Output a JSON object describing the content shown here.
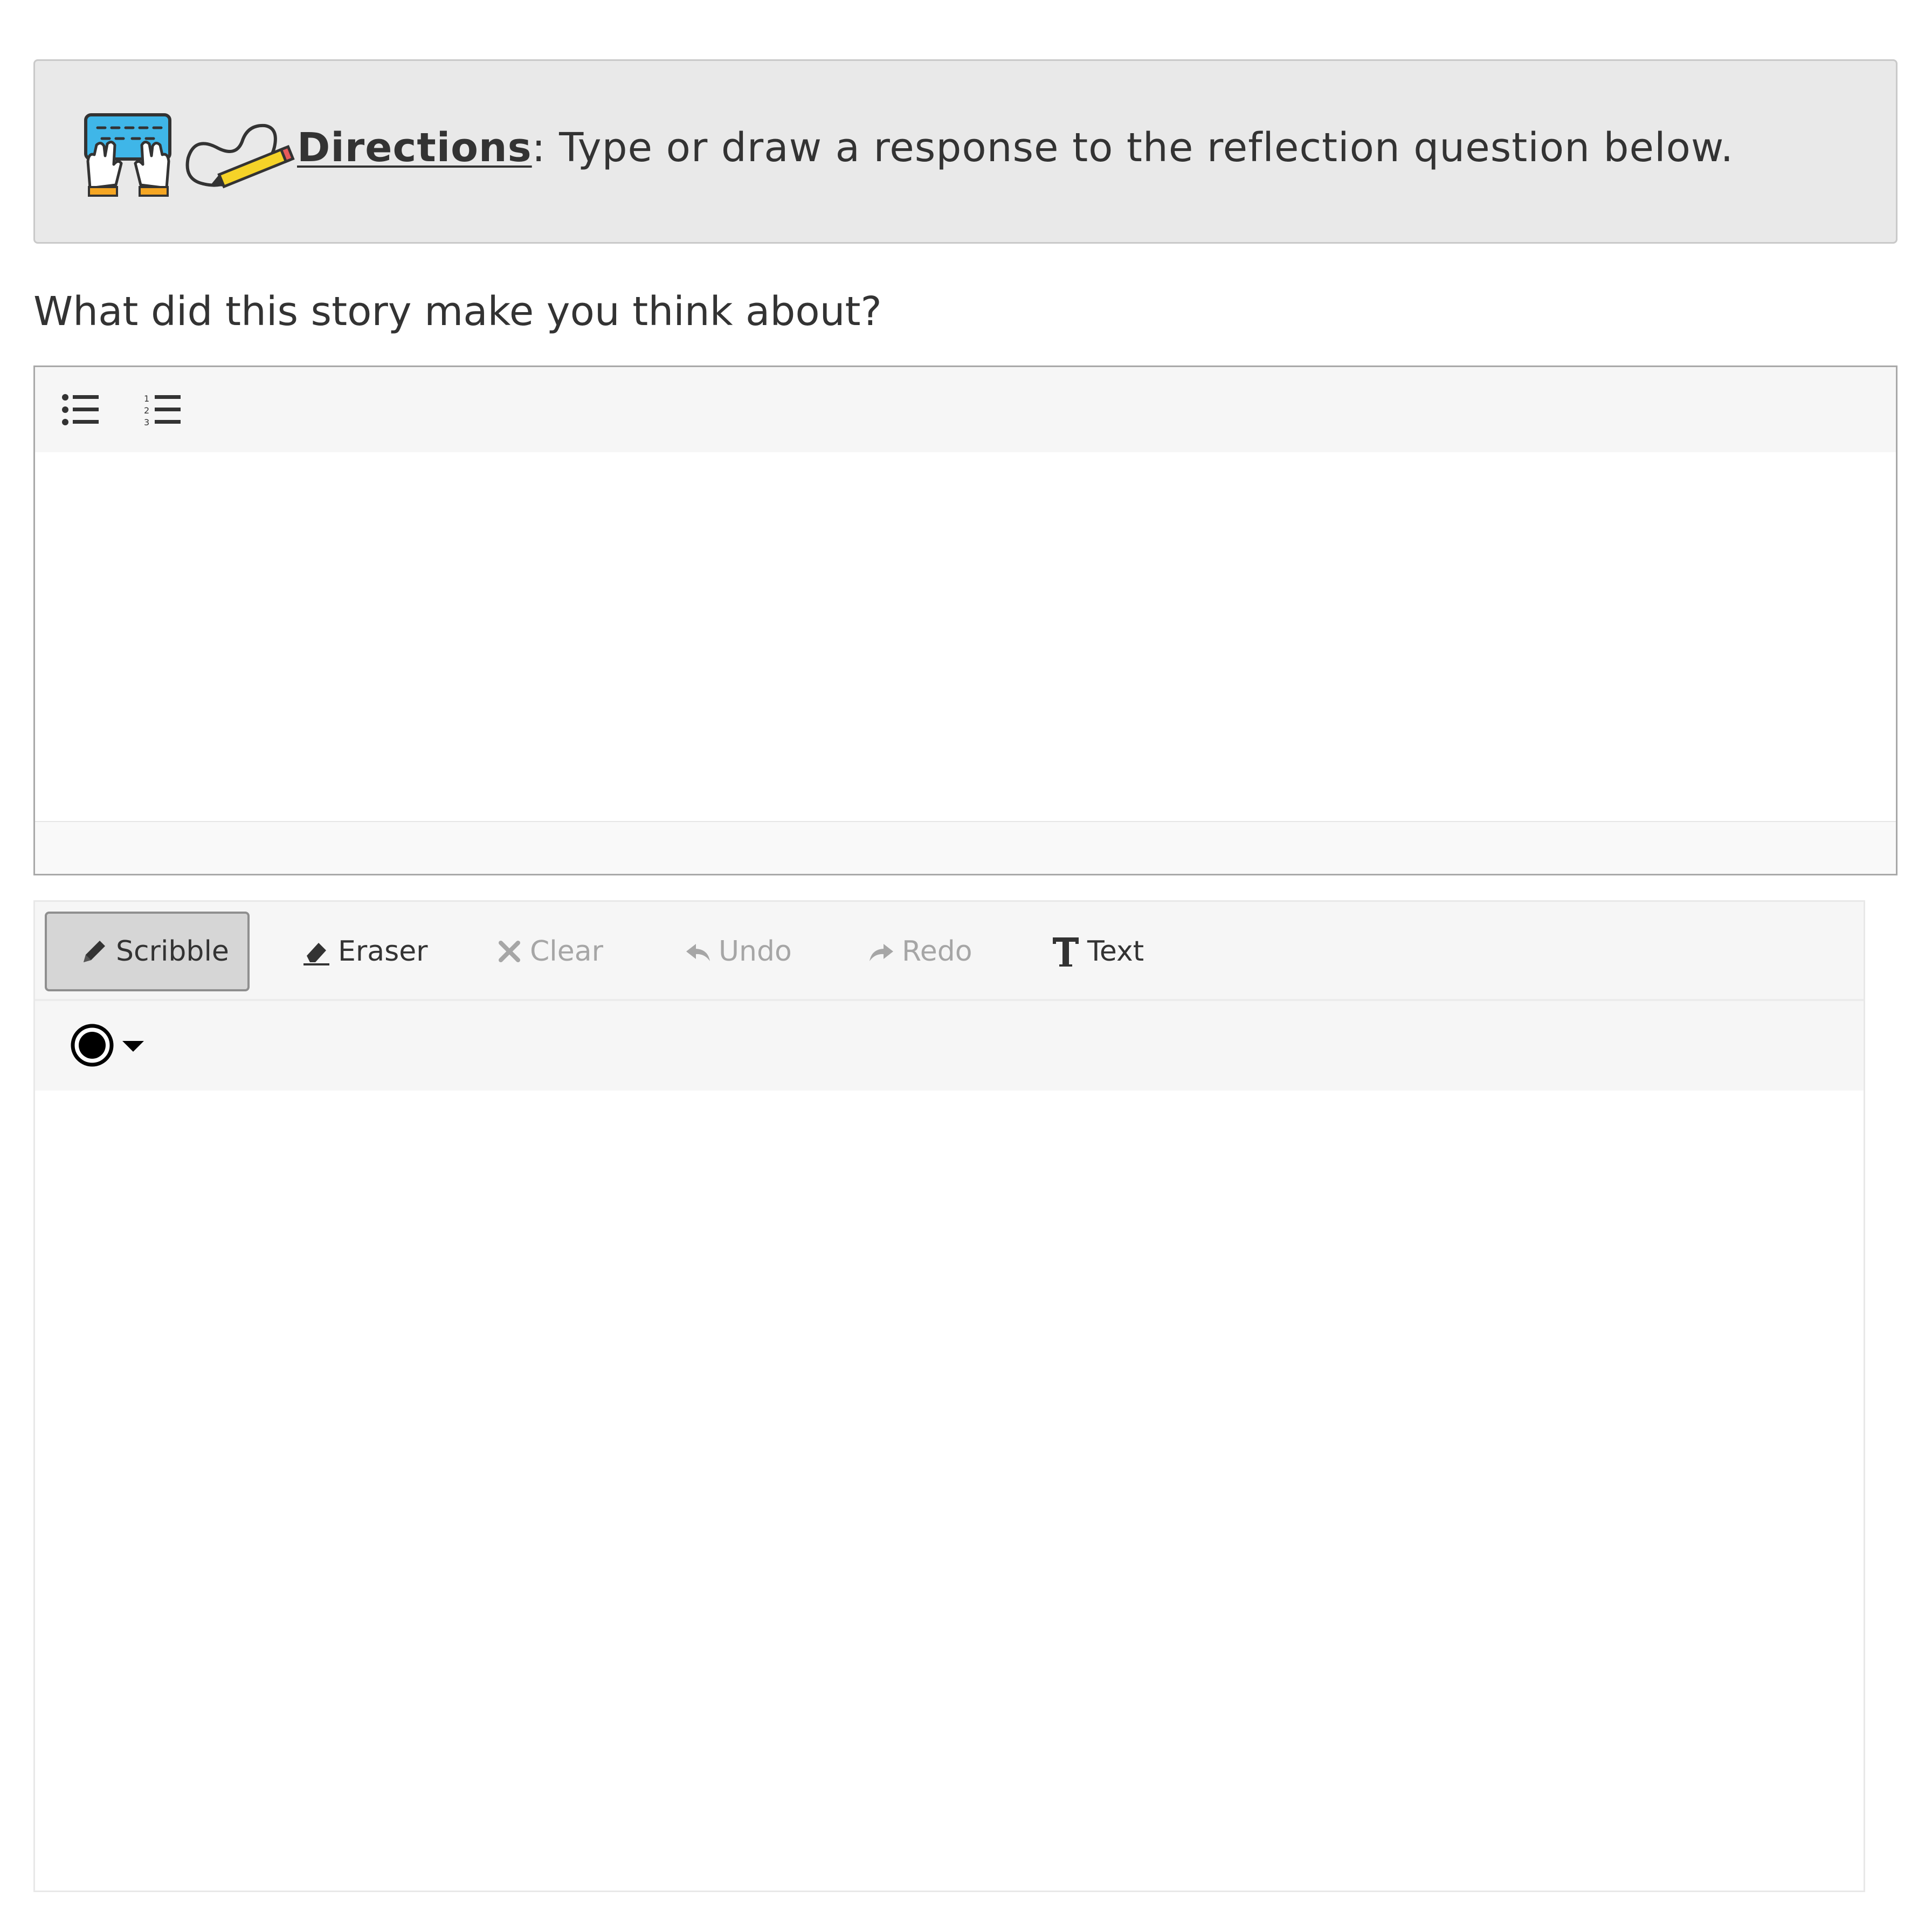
{
  "directions": {
    "label": "Directions",
    "text": ": Type or draw a response to the reflection question below."
  },
  "question": "What did this story make you think about?",
  "editor": {
    "toolbar": {
      "bulleted_list_icon": "list-ul-icon",
      "numbered_list_icon": "list-ol-icon"
    },
    "content": ""
  },
  "drawing": {
    "tools": [
      {
        "label": "Scribble",
        "icon": "pencil-icon",
        "active": true,
        "enabled": true
      },
      {
        "label": "Eraser",
        "icon": "eraser-icon",
        "active": false,
        "enabled": true
      },
      {
        "label": "Clear",
        "icon": "x-icon",
        "active": false,
        "enabled": false
      },
      {
        "label": "Undo",
        "icon": "undo-icon",
        "active": false,
        "enabled": false
      },
      {
        "label": "Redo",
        "icon": "redo-icon",
        "active": false,
        "enabled": false
      },
      {
        "label": "Text",
        "icon": "text-icon",
        "active": false,
        "enabled": true
      }
    ],
    "color": {
      "selected": "#000000",
      "icon": "color-circle-icon"
    }
  },
  "colors": {
    "directions_bg": "#e9e9e9",
    "toolbar_bg": "#f6f6f6",
    "text": "#333333",
    "disabled_text": "#a6a6a6",
    "keyboard_blue": "#3fb6e8",
    "pencil_yellow": "#f5d328"
  }
}
